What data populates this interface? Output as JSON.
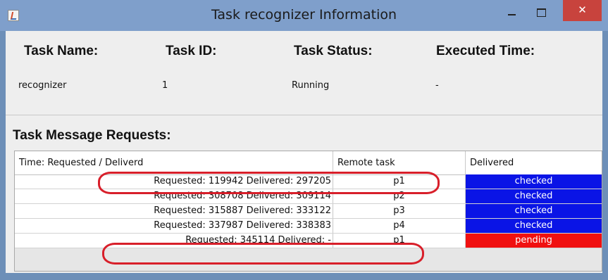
{
  "window": {
    "title": "Task recognizer Information",
    "close_glyph": "✕",
    "app_icon": "java-icon"
  },
  "info": {
    "headers": {
      "task_name": "Task Name:",
      "task_id": "Task ID:",
      "task_status": "Task Status:",
      "executed_time": "Executed Time:"
    },
    "values": {
      "task_name": "recognizer",
      "task_id": "1",
      "task_status": "Running",
      "executed_time": "-"
    }
  },
  "requests": {
    "title": "Task Message Requests:",
    "columns": [
      "Time: Requested / Deliverd",
      "Remote task",
      "Delivered"
    ],
    "rows": [
      {
        "time": "Requested: 119942 Delivered: 297205",
        "remote": "p1",
        "status": "checked"
      },
      {
        "time": "Requested: 308708 Delivered: 309114",
        "remote": "p2",
        "status": "checked"
      },
      {
        "time": "Requested: 315887 Delivered: 333122",
        "remote": "p3",
        "status": "checked"
      },
      {
        "time": "Requested: 337987 Delivered: 338383",
        "remote": "p4",
        "status": "checked"
      },
      {
        "time": "Requested: 345114 Delivered: -",
        "remote": "p1",
        "status": "pending"
      }
    ]
  },
  "colors": {
    "titlebar": "#7f9fcb",
    "checked": "#0a14e6",
    "pending": "#f01010",
    "highlight_oval": "#d81f2a"
  }
}
